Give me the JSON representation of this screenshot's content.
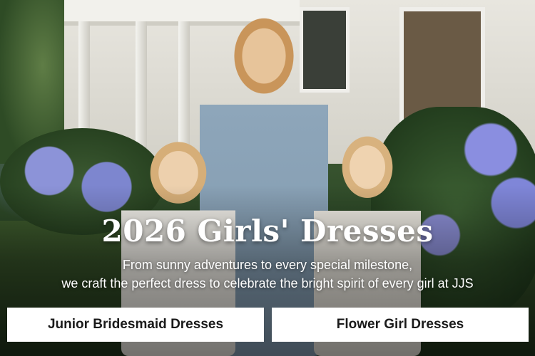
{
  "hero": {
    "headline": "2026 Girls' Dresses",
    "subline_1": "From sunny adventures to every special milestone,",
    "subline_2": "we craft the perfect dress to celebrate the bright spirit of every girl at JJS"
  },
  "buttons": [
    {
      "label": "Junior Bridesmaid Dresses"
    },
    {
      "label": "Flower Girl Dresses"
    }
  ],
  "colors": {
    "button_bg": "#ffffff",
    "button_text": "#1a1a1a",
    "text": "#ffffff"
  }
}
